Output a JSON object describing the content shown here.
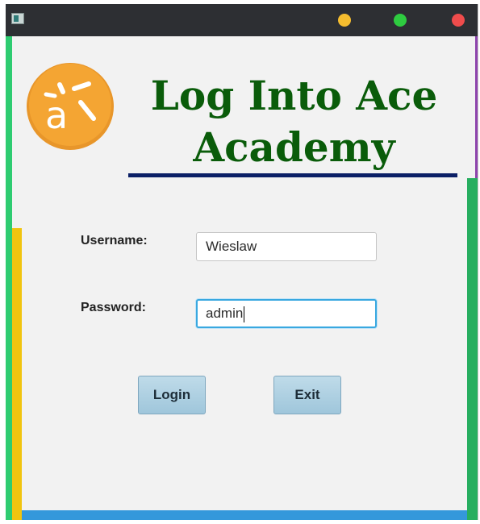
{
  "window": {
    "title_bar": {
      "icons": [
        "app-icon",
        "minimize-icon",
        "maximize-icon",
        "close-icon"
      ],
      "button_colors": {
        "minimize": "#f5bd2f",
        "maximize": "#2ecc40",
        "close": "#ef4c4c"
      }
    }
  },
  "header": {
    "logo_icon": "ace-academy-logo",
    "logo_color": "#f4a533",
    "title_line1": "Log Into Ace",
    "title_line2": "Academy",
    "title_color": "#0a5c0a",
    "rule_color": "#0b1f66"
  },
  "form": {
    "username_label": "Username:",
    "username_value": "Wieslaw",
    "password_label": "Password:",
    "password_value": "admin",
    "login_label": "Login",
    "exit_label": "Exit"
  },
  "accents": {
    "left": "#2ecc71",
    "yellow": "#f1c40f",
    "bottom": "#3498db",
    "right_top": "#8e44ad",
    "right_bottom": "#27ae60"
  }
}
